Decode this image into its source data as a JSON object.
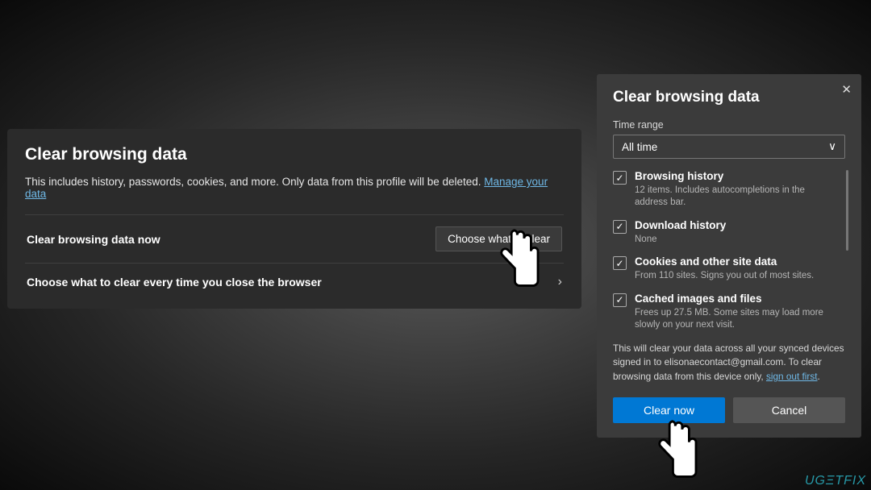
{
  "settings": {
    "title": "Clear browsing data",
    "subtitle_a": "This includes history, passwords, cookies, and more. Only data from this profile will be deleted. ",
    "manage_link": "Manage your data",
    "row1_label": "Clear browsing data now",
    "row1_button": "Choose what to clear",
    "row2_label": "Choose what to clear every time you close the browser"
  },
  "dialog": {
    "title": "Clear browsing data",
    "time_label": "Time range",
    "time_value": "All time",
    "options": [
      {
        "title": "Browsing history",
        "desc": "12 items. Includes autocompletions in the address bar."
      },
      {
        "title": "Download history",
        "desc": "None"
      },
      {
        "title": "Cookies and other site data",
        "desc": "From 110 sites. Signs you out of most sites."
      },
      {
        "title": "Cached images and files",
        "desc": "Frees up 27.5 MB. Some sites may load more slowly on your next visit."
      }
    ],
    "note_a": "This will clear your data across all your synced devices signed in to elisonaecontact@gmail.com. To clear browsing data from this device only, ",
    "note_link": "sign out first",
    "note_b": ".",
    "clear_btn": "Clear now",
    "cancel_btn": "Cancel"
  },
  "watermark": "UGΞTFIX"
}
